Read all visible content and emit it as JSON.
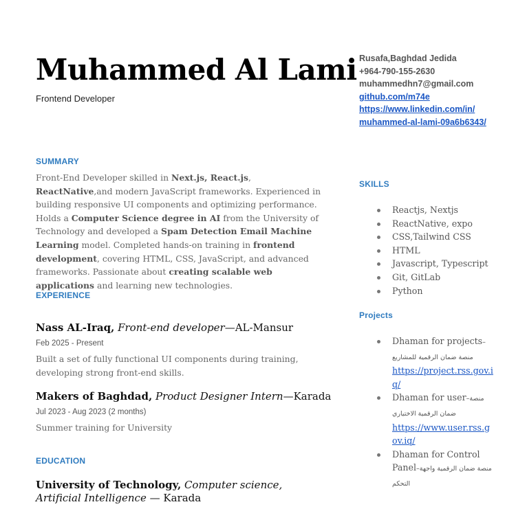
{
  "header": {
    "name": "Muhammed Al Lami",
    "role": "Frontend Developer"
  },
  "contact": {
    "address": "Rusafa,Baghdad Jedida",
    "phone": "+964-790-155-2630",
    "email": "muhammedhn7@gmail.com",
    "github": "github.com/m74e",
    "linkedin_line1": "https://www.linkedin.com/in/",
    "linkedin_line2": "muhammed-al-lami-09a6b6343/"
  },
  "summary": {
    "heading": "SUMMARY",
    "parts": {
      "p1": "Front-End Developer skilled in ",
      "b1": "Next.js, React.js",
      "p2": ", ",
      "b2": "ReactNative",
      "p3": ",and modern JavaScript frameworks. Experienced in building responsive UI components and optimizing performance. Holds a ",
      "b3": "Computer Science degree in AI",
      "p4": " from the University of Technology and developed a ",
      "b4": "Spam Detection Email Machine Learning",
      "p5": " model. Completed hands-on training in ",
      "b5": "frontend development",
      "p6": ", covering HTML, CSS, JavaScript, and advanced frameworks. Passionate about ",
      "b6": "creating scalable web applications",
      "p7": " and learning new technologies."
    }
  },
  "experience": {
    "heading": "EXPERIENCE",
    "jobs": [
      {
        "company": "Nass AL-Iraq,",
        "position": "Front-end developer",
        "location": "—AL-Mansur",
        "dates": "Feb 2025 - Present",
        "description": "Built a set of fully functional UI components during training, developing strong front-end skills."
      },
      {
        "company": "Makers of Baghdad,",
        "position": "Product Designer Intern",
        "location": "—Karada",
        "dates": "Jul 2023 - Aug 2023 (2 months)",
        "description": "Summer training for University"
      }
    ]
  },
  "education": {
    "heading": "EDUCATION",
    "school": "University of Technology,",
    "degree": "Computer science, Artificial Intelligence",
    "location": " — Karada"
  },
  "skills": {
    "heading": "SKILLS",
    "items": [
      "Reactjs, Nextjs",
      "ReactNative, expo",
      "CSS,Tailwind CSS",
      "HTML",
      "Javascript, Typescript",
      "Git, GitLab",
      "Python"
    ]
  },
  "projects": {
    "heading": "Projects",
    "items": [
      {
        "title": "Dhaman for projects",
        "arabic": "–منصة ضمان الرقمية للمشاريع",
        "link": "https://project.rss.gov.iq/"
      },
      {
        "title": "Dhaman for user",
        "arabic": "–منصة ضمان الرقمية الاختياري",
        "link": "https://www.user.rss.gov.iq/"
      },
      {
        "title": "Dhaman for Control Panel",
        "arabic": "–منصة ضمان الرقمية واجهة التحكم",
        "link": ""
      }
    ]
  },
  "colors": {
    "accent": "#2f7bbf",
    "link": "#1a56c4"
  }
}
